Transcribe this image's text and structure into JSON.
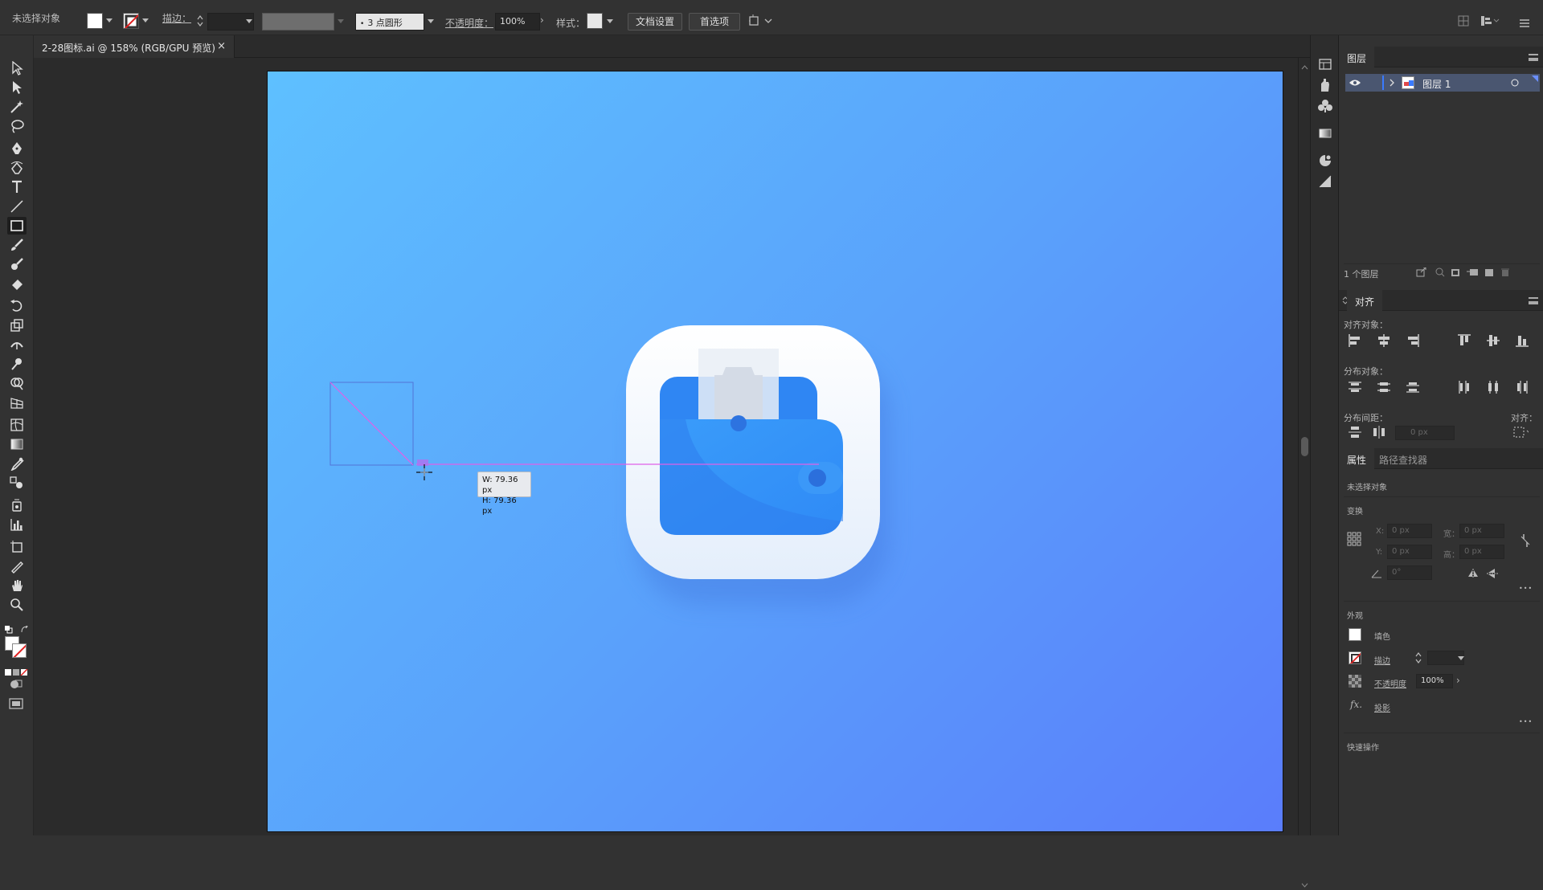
{
  "control_bar": {
    "selection_status": "未选择对象",
    "stroke_label": "描边：",
    "brush_value": "3 点圆形",
    "opacity_label": "不透明度：",
    "opacity_value": "100%",
    "style_label": "样式：",
    "doc_settings_button": "文档设置",
    "preferences_button": "首选项"
  },
  "document_tab": {
    "title": "2-28图标.ai @ 158% (RGB/GPU 预览)",
    "close_glyph": "×"
  },
  "canvas": {
    "artboard_gradient": [
      "#5ec0ff",
      "#5aa2fb",
      "#5a7dfb"
    ],
    "measure_tooltip": {
      "width": "W: 79.36 px",
      "height": "H: 79.36 px"
    },
    "guide_color": "#e060e8"
  },
  "layers_panel": {
    "tab_label": "图层",
    "layers": [
      {
        "name": "图层 1",
        "visible": true
      }
    ],
    "count_label": "1 个图层"
  },
  "align_panel": {
    "tab_label": "对齐",
    "align_objects_label": "对齐对象：",
    "distribute_objects_label": "分布对象：",
    "distribute_spacing_label": "分布间距：",
    "align_to_label": "对齐：",
    "spacing_value": "0 px"
  },
  "properties_panel": {
    "tab_properties": "属性",
    "tab_pathfinder": "路径查找器",
    "selection_status": "未选择对象",
    "transform_label": "变换",
    "x_label": "X:",
    "y_label": "Y:",
    "w_label": "宽：",
    "h_label": "高：",
    "x_value": "0 px",
    "y_value": "0 px",
    "w_value": "0 px",
    "h_value": "0 px",
    "angle_value": "0°",
    "appearance_label": "外观",
    "fill_label": "填色",
    "stroke_label": "描边",
    "opacity_label": "不透明度",
    "opacity_value": "100%",
    "fx_label": "fx.",
    "shadow_label": "投影",
    "quick_actions_label": "快速操作",
    "more_glyph": "•••"
  }
}
